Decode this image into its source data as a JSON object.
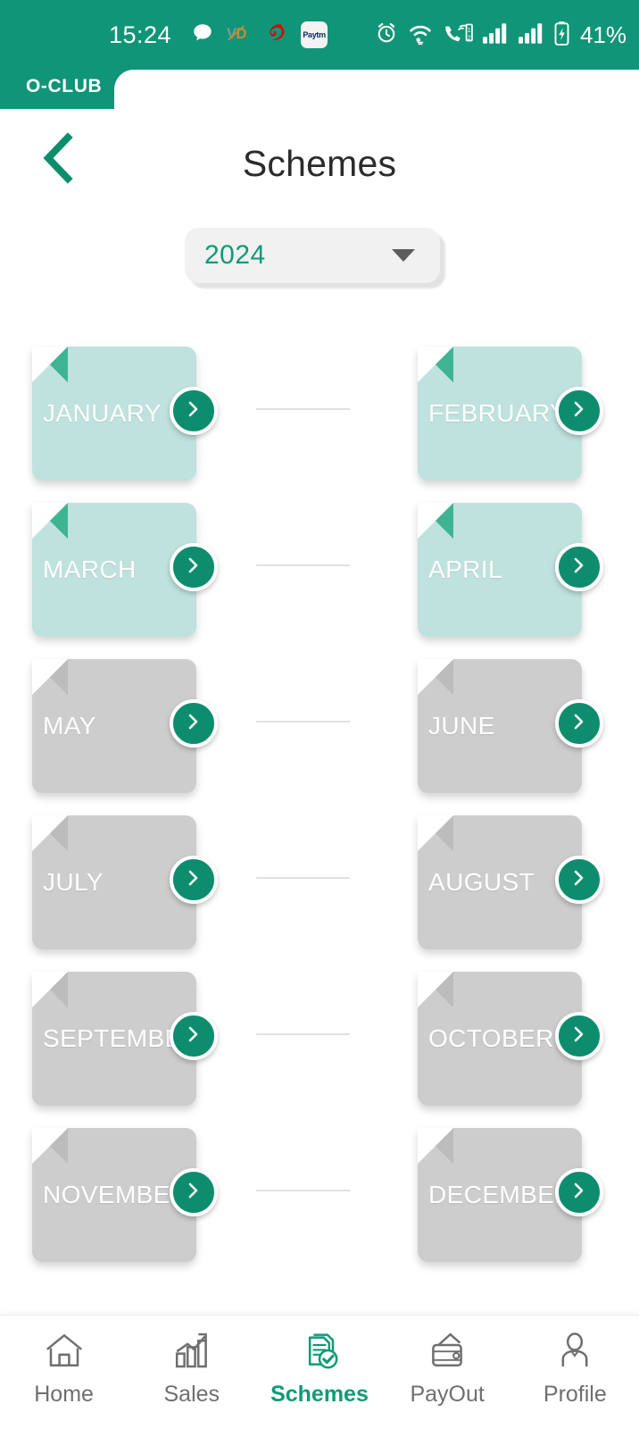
{
  "statusbar": {
    "time": "15:24",
    "battery_percent": "41%",
    "notification_icons": [
      "chat-bubble-icon",
      "vd-app-icon",
      "airtel-icon",
      "paytm-icon"
    ],
    "system_icons": [
      "alarm-icon",
      "wifi-icon",
      "volte-call-icon",
      "signal-sim1-icon",
      "signal-sim2-icon",
      "battery-charging-icon"
    ],
    "bg_color": "#109578"
  },
  "tab": {
    "label": "O-CLUB"
  },
  "header": {
    "title": "Schemes",
    "back_icon": "chevron-left-icon"
  },
  "year_filter": {
    "value": "2024",
    "caret_icon": "caret-down-icon"
  },
  "months": [
    {
      "label": "JANUARY",
      "state": "active",
      "arrow_icon": "chevron-right-icon"
    },
    {
      "label": "FEBRUARY",
      "state": "active",
      "arrow_icon": "chevron-right-icon"
    },
    {
      "label": "MARCH",
      "state": "active",
      "arrow_icon": "chevron-right-icon"
    },
    {
      "label": "APRIL",
      "state": "active",
      "arrow_icon": "chevron-right-icon"
    },
    {
      "label": "MAY",
      "state": "inactive",
      "arrow_icon": "chevron-right-icon"
    },
    {
      "label": "JUNE",
      "state": "inactive",
      "arrow_icon": "chevron-right-icon"
    },
    {
      "label": "JULY",
      "state": "inactive",
      "arrow_icon": "chevron-right-icon"
    },
    {
      "label": "AUGUST",
      "state": "inactive",
      "arrow_icon": "chevron-right-icon"
    },
    {
      "label": "SEPTEMBER",
      "state": "inactive",
      "arrow_icon": "chevron-right-icon"
    },
    {
      "label": "OCTOBER",
      "state": "inactive",
      "arrow_icon": "chevron-right-icon"
    },
    {
      "label": "NOVEMBER",
      "state": "inactive",
      "arrow_icon": "chevron-right-icon"
    },
    {
      "label": "DECEMBER",
      "state": "inactive",
      "arrow_icon": "chevron-right-icon"
    }
  ],
  "bottom_nav": {
    "active": "Schemes",
    "items": [
      {
        "label": "Home",
        "icon": "home-icon"
      },
      {
        "label": "Sales",
        "icon": "bar-chart-growth-icon"
      },
      {
        "label": "Schemes",
        "icon": "document-check-icon"
      },
      {
        "label": "PayOut",
        "icon": "wallet-icon"
      },
      {
        "label": "Profile",
        "icon": "person-icon"
      }
    ]
  },
  "colors": {
    "brand_green": "#109578",
    "accent_green": "#0f9b77",
    "card_active": "#bfe2de",
    "card_active_fold": "#3fb493",
    "card_inactive": "#cdcdcd",
    "card_inactive_fold": "#bcbcbc",
    "connector_line": "#e1e1e1"
  }
}
